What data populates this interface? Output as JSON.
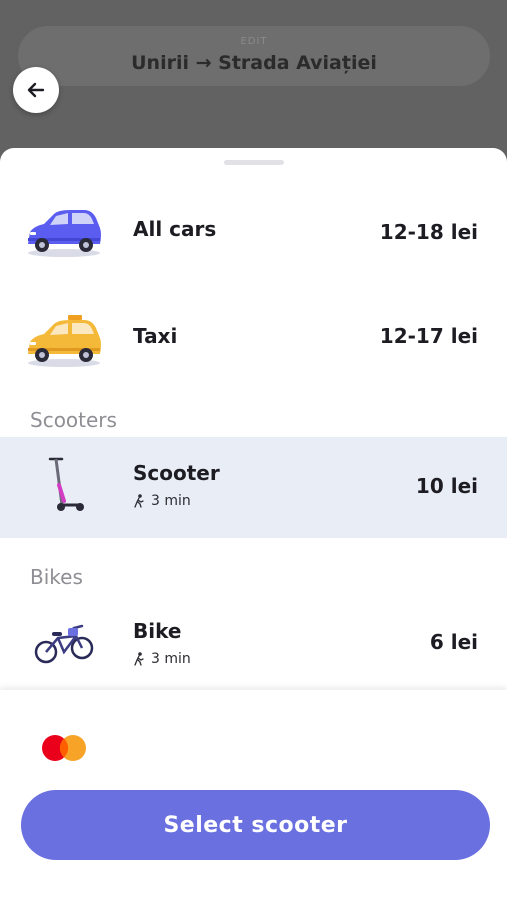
{
  "header": {
    "edit_label": "EDIT",
    "route": "Unirii → Strada Aviației"
  },
  "options": {
    "all_cars": {
      "title": "All cars",
      "price": "12-18 lei"
    },
    "taxi": {
      "title": "Taxi",
      "price": "12-17 lei"
    }
  },
  "scooters_section": {
    "heading": "Scooters",
    "item": {
      "title": "Scooter",
      "walk_time": "3 min",
      "price": "10 lei"
    }
  },
  "bikes_section": {
    "heading": "Bikes",
    "item": {
      "title": "Bike",
      "walk_time": "3 min",
      "price": "6 lei"
    }
  },
  "footer": {
    "button_label": "Select scooter"
  },
  "colors": {
    "accent": "#6a70e0",
    "selected_row": "#e9eef6",
    "car": "#5b5cf0",
    "taxi": "#f5b93a"
  }
}
